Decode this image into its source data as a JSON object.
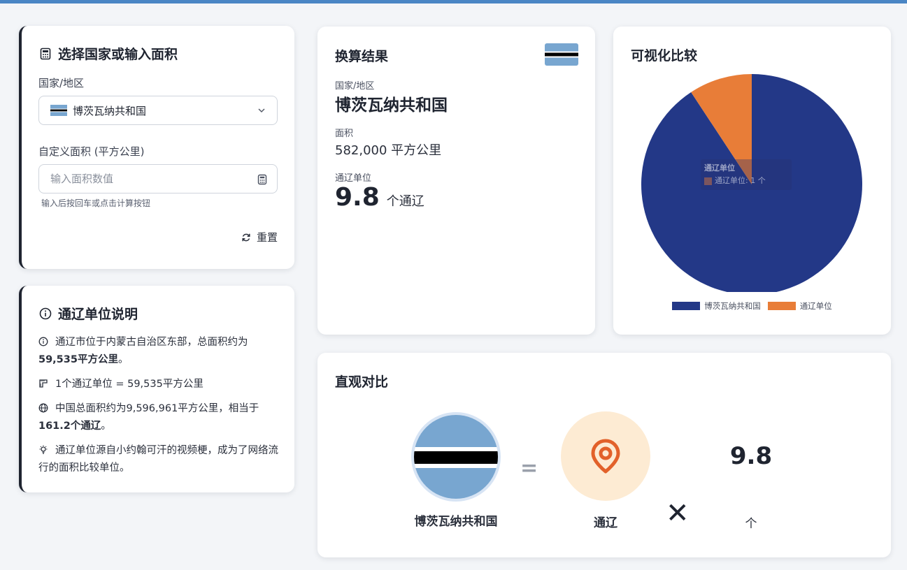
{
  "select_card": {
    "title": "选择国家或输入面积",
    "country_label": "国家/地区",
    "selected_country": "博茨瓦纳共和国",
    "area_label": "自定义面积 (平方公里)",
    "area_placeholder": "输入面积数值",
    "area_value": "",
    "hint": "输入后按回车或点击计算按钮",
    "reset_label": "重置"
  },
  "info_card": {
    "title": "通辽单位说明",
    "item1_text": "通辽市位于内蒙古自治区东部，总面积约为",
    "item1_bold": "59,535平方公里",
    "item1_tail": "。",
    "item2_text": "1个通辽单位 = 59,535平方公里",
    "item3_text": "中国总面积约为9,596,961平方公里，相当于",
    "item3_bold": "161.2个通辽",
    "item3_tail": "。",
    "item4_text": "通辽单位源自小约翰可汗的视频梗，成为了网络流行的面积比较单位。"
  },
  "result_card": {
    "title": "换算结果",
    "country_label": "国家/地区",
    "country_name": "博茨瓦纳共和国",
    "area_label": "面积",
    "area_value": "582,000 平方公里",
    "unit_label": "通辽单位",
    "unit_value": "9.8",
    "unit_suffix": "个通辽"
  },
  "pie_card": {
    "title": "可视化比较",
    "tooltip_title": "通辽单位",
    "tooltip_text": "通辽单位: 1 个",
    "legend": [
      "博茨瓦纳共和国",
      "通辽单位"
    ]
  },
  "chart_data": {
    "type": "pie",
    "labels": [
      "博茨瓦纳共和国",
      "通辽单位"
    ],
    "values": [
      9.8,
      1
    ],
    "colors": [
      "#233887",
      "#e87d38"
    ]
  },
  "compare_card": {
    "title": "直观对比",
    "country_name": "博茨瓦纳共和国",
    "equals": "=",
    "tongliao_label": "通辽",
    "times": "✕",
    "multiplier": "9.8",
    "unit": "个"
  },
  "colors": {
    "accent": "#4a86c5",
    "pie_country": "#233887",
    "pie_tongliao": "#e87d38",
    "flag_blue": "#78a6d0",
    "pin_bg": "#fdebd3",
    "pin": "#e2612a"
  }
}
